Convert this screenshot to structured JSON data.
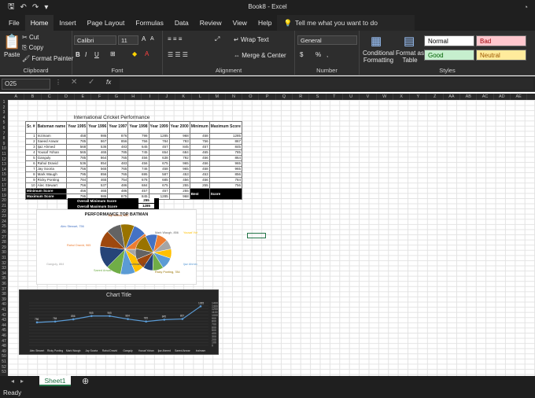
{
  "app": {
    "title": "Book8 - Excel",
    "user_icon": "account-icon"
  },
  "quick_access": [
    "save-icon",
    "undo-icon",
    "redo-icon",
    "customize-icon"
  ],
  "tabs": [
    "File",
    "Home",
    "Insert",
    "Page Layout",
    "Formulas",
    "Data",
    "Review",
    "View",
    "Help"
  ],
  "active_tab": "Home",
  "tellme": "Tell me what you want to do",
  "ribbon": {
    "clipboard": {
      "label": "Clipboard",
      "paste": "Paste",
      "cut": "Cut",
      "copy": "Copy",
      "format_painter": "Format Painter"
    },
    "font": {
      "label": "Font",
      "family": "Calibri",
      "size": "11",
      "bold": "B",
      "italic": "I",
      "underline": "U"
    },
    "alignment": {
      "label": "Alignment",
      "wrap": "Wrap Text",
      "merge": "Merge & Center"
    },
    "number": {
      "label": "Number",
      "format": "General",
      "currency": "$",
      "percent": "%",
      "comma": ","
    },
    "styles": {
      "label": "Styles",
      "conditional": "Conditional Formatting",
      "table": "Format as Table",
      "normal": "Normal",
      "bad": "Bad",
      "good": "Good",
      "neutral": "Neutral"
    }
  },
  "formula_bar": {
    "name_box": "O25",
    "fx": "fx",
    "value": ""
  },
  "columns": [
    "A",
    "B",
    "C",
    "D",
    "E",
    "F",
    "G",
    "H",
    "I",
    "J",
    "K",
    "L",
    "M",
    "N",
    "O",
    "P",
    "Q",
    "R",
    "S",
    "T",
    "U",
    "V",
    "W",
    "X",
    "Y",
    "Z",
    "AA",
    "AB",
    "AC",
    "AD",
    "AE"
  ],
  "sheet": {
    "title": "International Cricket Performance",
    "headers": [
      "Sr. #",
      "Batsman name",
      "Year 1995",
      "Year 1996",
      "Year 1997",
      "Year 1998",
      "Year 1999",
      "Year 2000",
      "Minimum",
      "Maximum Score"
    ],
    "rows": [
      [
        "1",
        "Inzimam",
        "458",
        "986",
        "876",
        "798",
        "1285",
        "968",
        "458",
        "1285"
      ],
      [
        "2",
        "Saeed Anwar",
        "785",
        "867",
        "856",
        "756",
        "784",
        "793",
        "756",
        "867"
      ],
      [
        "3",
        "Ijaz Ahmed",
        "568",
        "536",
        "483",
        "645",
        "457",
        "845",
        "457",
        "845"
      ],
      [
        "4",
        "Yousaf Yohan",
        "565",
        "465",
        "785",
        "745",
        "654",
        "684",
        "465",
        "785"
      ],
      [
        "5",
        "Ganguly",
        "785",
        "864",
        "765",
        "456",
        "638",
        "792",
        "456",
        "864"
      ],
      [
        "6",
        "Rahul Dravid",
        "536",
        "854",
        "483",
        "456",
        "675",
        "965",
        "456",
        "965"
      ],
      [
        "7",
        "Jay Sooria",
        "756",
        "565",
        "765",
        "746",
        "458",
        "965",
        "458",
        "965"
      ],
      [
        "8",
        "Mark Waugh",
        "795",
        "856",
        "765",
        "695",
        "587",
        "453",
        "453",
        "856"
      ],
      [
        "9",
        "Ricky Ponting",
        "784",
        "465",
        "754",
        "678",
        "685",
        "456",
        "456",
        "784"
      ],
      [
        "10",
        "Alec Stewart",
        "756",
        "537",
        "486",
        "684",
        "675",
        "255",
        "255",
        "756"
      ]
    ],
    "min_row": [
      "Minimum Score",
      "456",
      "465",
      "486",
      "457",
      "457",
      "255"
    ],
    "max_row": [
      "Maximum Score",
      "795",
      "986",
      "875",
      "845",
      "1285",
      "968"
    ],
    "best": "Best",
    "score": "Score",
    "overall_min": "Overall Minimum Score",
    "overall_min_val": "255",
    "overall_max": "Overall Maximum Score",
    "overall_max_val": "1285"
  },
  "chart_data": [
    {
      "type": "pie",
      "title": "PERFORMANCE TOP BATMAN",
      "categories": [
        "Alec Stewart",
        "Rahul Dravid",
        "Ganguly",
        "Yousaf Yohan",
        "Ijaz Ahmed",
        "Saeed Anwar",
        "Inzimam",
        "Jay Sooria",
        "Mark Waugh",
        "Ricky Ponting"
      ],
      "values": [
        756,
        965,
        864,
        785,
        845,
        867,
        1285,
        965,
        856,
        784
      ],
      "colors": [
        "#4472c4",
        "#ed7d31",
        "#a5a5a5",
        "#ffc000",
        "#5b9bd5",
        "#70ad47",
        "#264478",
        "#9e480e",
        "#636363",
        "#997300"
      ]
    },
    {
      "type": "line",
      "title": "Chart Title",
      "categories": [
        "Alec Stewart",
        "Ricky Ponting",
        "Mark Waugh",
        "Jay Sooria",
        "Rahul Dravid",
        "Ganguly",
        "Yousaf Yohan",
        "Ijaz Ahmed",
        "Saeed Anwar",
        "Inzimam"
      ],
      "values": [
        756,
        784,
        856,
        965,
        965,
        864,
        785,
        845,
        867,
        1285
      ],
      "ylim": [
        0,
        1400
      ]
    }
  ],
  "sheet_tab": "Sheet1",
  "status": "Ready"
}
